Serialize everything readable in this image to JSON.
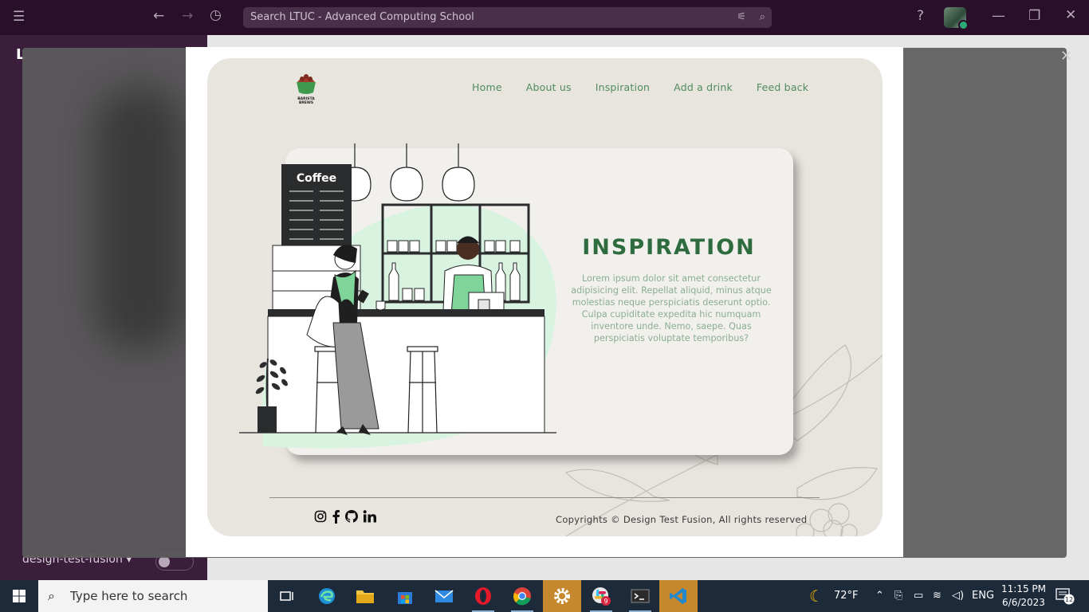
{
  "slack": {
    "search_placeholder": "Search LTUC - Advanced Computing School",
    "workspace_initial": "L",
    "footer_channel": "design-test-fusion"
  },
  "site": {
    "brand": "BARISTA BREWS",
    "nav": [
      "Home",
      "About us",
      "Inspiration",
      "Add a drink",
      "Feed back"
    ],
    "menu_board": "Coffee",
    "title": "INSPIRATION",
    "body": "Lorem ipsum dolor sit amet consectetur adipisicing elit. Repellat aliquid, minus atque molestias neque perspiciatis deserunt optio. Culpa cupiditate expedita hic numquam inventore unde. Nemo, saepe. Quas perspiciatis voluptate temporibus?",
    "copyright": "Copyrights © Design Test Fusion, All rights reserved",
    "socials": [
      "instagram-icon",
      "facebook-icon",
      "github-icon",
      "linkedin-icon"
    ],
    "colors": {
      "accent_green": "#4f8b5c",
      "title_green": "#2e6b3f",
      "mint": "#d9f3e1",
      "page_bg": "#e8e5df"
    }
  },
  "taskbar": {
    "search_placeholder": "Type here to search",
    "weather": "72°F",
    "language": "ENG",
    "time": "11:15 PM",
    "date": "6/6/2023",
    "notifications": "12",
    "slack_badge": "9"
  }
}
